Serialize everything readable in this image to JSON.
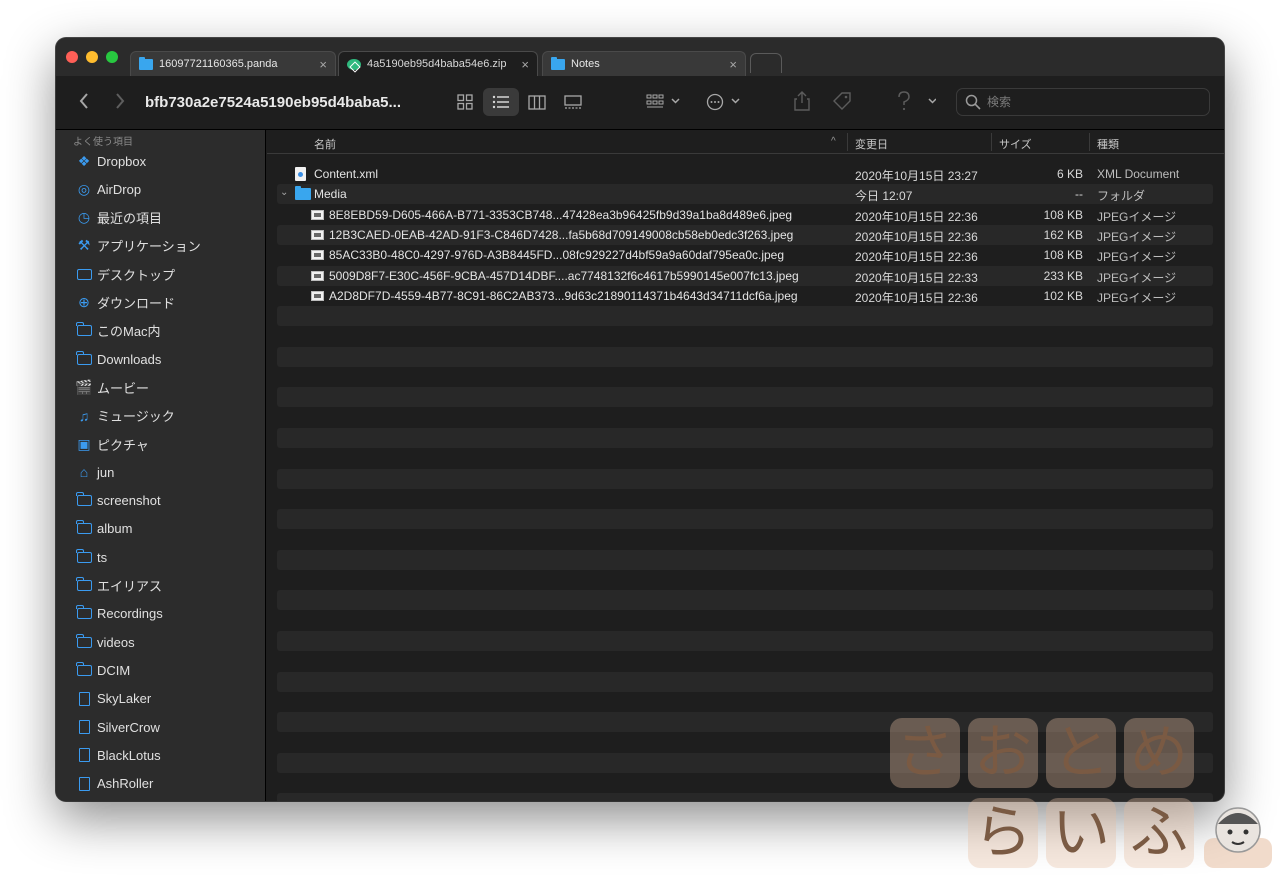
{
  "tabs": [
    {
      "label": "16097721160365.panda",
      "icon": "folder-icon",
      "active": false,
      "close": "×"
    },
    {
      "label": "4a5190eb95d4baba54e6.zip",
      "icon": "zip-icon",
      "active": true,
      "close": "×"
    },
    {
      "label": "Notes",
      "icon": "folder-icon",
      "active": false,
      "close": "×"
    }
  ],
  "toolbar": {
    "path_title": "bfb730a2e7524a5190eb95d4baba5...",
    "search_placeholder": "検索",
    "back_icon": "chevron-left-icon",
    "forward_icon": "chevron-right-icon"
  },
  "sidebar": {
    "heading": "よく使う項目",
    "items": [
      {
        "label": "Dropbox",
        "icon": "dropbox-icon"
      },
      {
        "label": "AirDrop",
        "icon": "airdrop-icon"
      },
      {
        "label": "最近の項目",
        "icon": "clock-icon"
      },
      {
        "label": "アプリケーション",
        "icon": "applications-icon"
      },
      {
        "label": "デスクトップ",
        "icon": "desktop-icon"
      },
      {
        "label": "ダウンロード",
        "icon": "download-icon"
      },
      {
        "label": "このMac内",
        "icon": "folder-icon"
      },
      {
        "label": "Downloads",
        "icon": "folder-icon"
      },
      {
        "label": "ムービー",
        "icon": "movie-icon"
      },
      {
        "label": "ミュージック",
        "icon": "music-icon"
      },
      {
        "label": "ピクチャ",
        "icon": "picture-icon"
      },
      {
        "label": "jun",
        "icon": "home-icon"
      },
      {
        "label": "screenshot",
        "icon": "folder-icon"
      },
      {
        "label": "album",
        "icon": "folder-icon"
      },
      {
        "label": "ts",
        "icon": "folder-icon"
      },
      {
        "label": "エイリアス",
        "icon": "folder-icon"
      },
      {
        "label": "Recordings",
        "icon": "folder-icon"
      },
      {
        "label": "videos",
        "icon": "folder-icon"
      },
      {
        "label": "DCIM",
        "icon": "folder-icon"
      },
      {
        "label": "SkyLaker",
        "icon": "document-icon"
      },
      {
        "label": "SilverCrow",
        "icon": "document-icon"
      },
      {
        "label": "BlackLotus",
        "icon": "document-icon"
      },
      {
        "label": "AshRoller",
        "icon": "document-icon"
      }
    ]
  },
  "columns": {
    "name": "名前",
    "date": "変更日",
    "size": "サイズ",
    "kind": "種類"
  },
  "files": [
    {
      "name": "Content.xml",
      "date": "2020年10月15日 23:27",
      "size": "6 KB",
      "kind": "XML Document",
      "icon": "xml-document-icon",
      "indent": 0
    },
    {
      "name": "Media",
      "date": "今日 12:07",
      "size": "--",
      "kind": "フォルダ",
      "icon": "folder-icon",
      "indent": 0,
      "expanded": true
    },
    {
      "name": "8E8EBD59-D605-466A-B771-3353CB748...47428ea3b96425fb9d39a1ba8d489e6.jpeg",
      "date": "2020年10月15日 22:36",
      "size": "108 KB",
      "kind": "JPEGイメージ",
      "icon": "image-icon",
      "indent": 1
    },
    {
      "name": "12B3CAED-0EAB-42AD-91F3-C846D7428...fa5b68d709149008cb58eb0edc3f263.jpeg",
      "date": "2020年10月15日 22:36",
      "size": "162 KB",
      "kind": "JPEGイメージ",
      "icon": "image-icon",
      "indent": 1
    },
    {
      "name": "85AC33B0-48C0-4297-976D-A3B8445FD...08fc929227d4bf59a9a60daf795ea0c.jpeg",
      "date": "2020年10月15日 22:36",
      "size": "108 KB",
      "kind": "JPEGイメージ",
      "icon": "image-icon",
      "indent": 1
    },
    {
      "name": "5009D8F7-E30C-456F-9CBA-457D14DBF....ac7748132f6c4617b5990145e007fc13.jpeg",
      "date": "2020年10月15日 22:33",
      "size": "233 KB",
      "kind": "JPEGイメージ",
      "icon": "image-icon",
      "indent": 1
    },
    {
      "name": "A2D8DF7D-4559-4B77-8C91-86C2AB373...9d63c21890114371b4643d34711dcf6a.jpeg",
      "date": "2020年10月15日 22:36",
      "size": "102 KB",
      "kind": "JPEGイメージ",
      "icon": "image-icon",
      "indent": 1
    }
  ],
  "watermark": {
    "line1": [
      "さ",
      "お",
      "と",
      "め"
    ],
    "line2": [
      "ら",
      "い",
      "ふ"
    ]
  },
  "colors": {
    "accent": "#3b9bf0",
    "window_bg": "#1e1e1e",
    "sidebar_bg": "#2c2c2c"
  }
}
